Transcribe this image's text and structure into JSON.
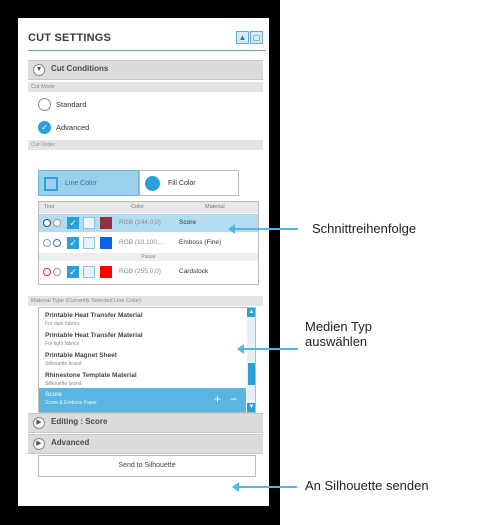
{
  "panel": {
    "title": "CUT SETTINGS",
    "header_buttons": [
      "▲",
      "▢"
    ],
    "cut_conditions": {
      "label": "Cut Conditions",
      "cut_mode_label": "Cut Mode",
      "modes": [
        "Standard",
        "Advanced"
      ],
      "selected_mode": "Advanced",
      "cut_order_label": "Cut Order",
      "order_options": [
        "Line Color",
        "Fill Color"
      ],
      "selected_order": "Line Color",
      "table": {
        "headers": [
          "Tool",
          "Color",
          "Material"
        ],
        "rows": [
          {
            "rgb": "RGB (144,0,0)",
            "material": "Score",
            "swatch": "#903040",
            "selected": true
          },
          {
            "rgb": "RGB (10,100,…",
            "material": "Emboss (Fine)",
            "swatch": "#0a64e0",
            "selected": false
          }
        ],
        "pause_label": "Pause",
        "rows_after_pause": [
          {
            "rgb": "RGB (255,0,0)",
            "material": "Cardstock",
            "swatch": "#ff0000",
            "selected": false
          }
        ]
      }
    },
    "material_type": {
      "label": "Material Type (Currently Selected Line Color)",
      "items": [
        {
          "name": "Printable Heat Transfer Material",
          "sub": "For dark fabrics"
        },
        {
          "name": "Printable Heat Transfer Material",
          "sub": "For light fabrics"
        },
        {
          "name": "Printable Magnet Sheet",
          "sub": "Silhouette brand"
        },
        {
          "name": "Rhinestone Template Material",
          "sub": "Silhouette brand"
        }
      ],
      "selected_item": {
        "name": "Score",
        "sub": "Score & Emboss Paper"
      },
      "add_symbol": "+",
      "remove_symbol": "−"
    },
    "editing_label": "Editing : Score",
    "advanced_label": "Advanced",
    "send_button": "Send to Silhouette"
  },
  "annotations": {
    "cut_order": "Schnittreihenfolge",
    "media_type_line1": "Medien Typ",
    "media_type_line2": "auswählen",
    "send": "An Silhouette senden"
  },
  "colors": {
    "accent": "#2a9fd8",
    "arrow": "#52b8e0"
  }
}
